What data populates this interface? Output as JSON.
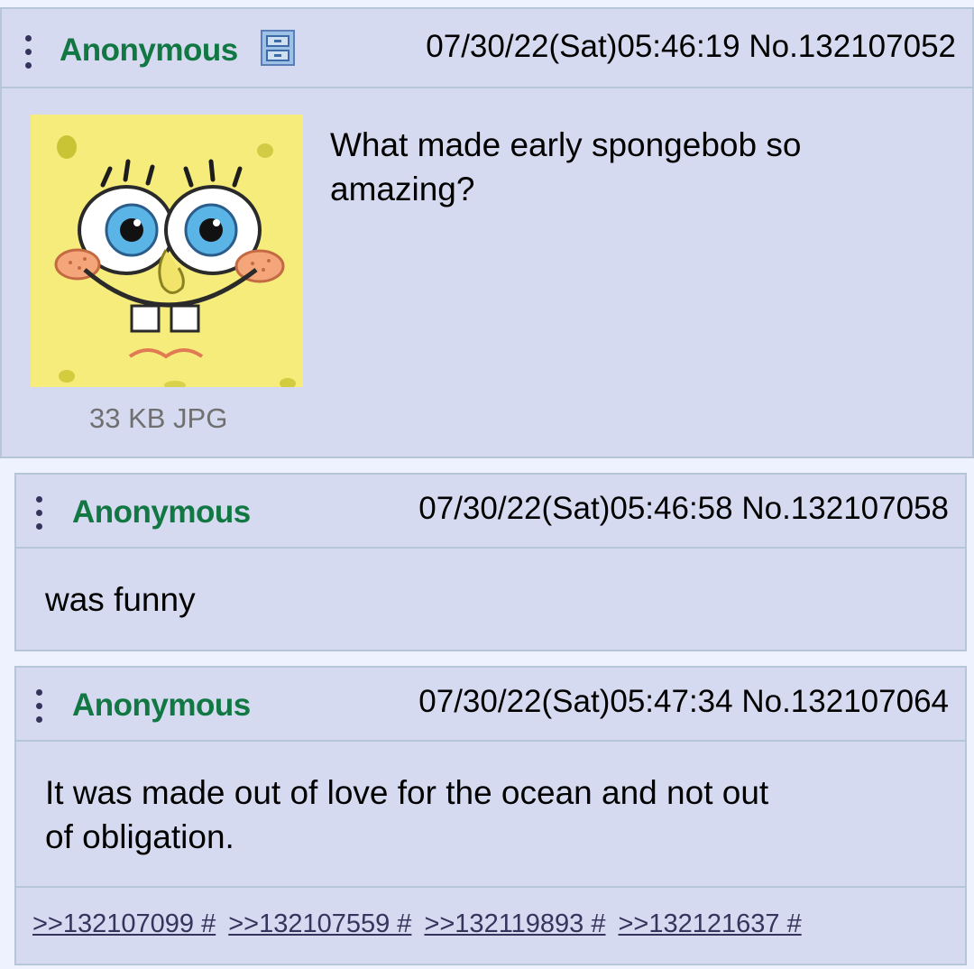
{
  "op": {
    "name": "Anonymous",
    "date": "07/30/22(Sat)05:46:19",
    "post_no": "No.132107052",
    "comment_line1": "What made early spongebob so",
    "comment_line2": "amazing?",
    "file_info": "33 KB JPG",
    "icons": {
      "menu": "menu-dots-icon",
      "file": "file-cabinet-icon",
      "thumbnail": "spongebob-face-thumbnail"
    }
  },
  "replies": [
    {
      "name": "Anonymous",
      "date": "07/30/22(Sat)05:46:58",
      "post_no": "No.132107058",
      "lines": [
        "was funny"
      ]
    },
    {
      "name": "Anonymous",
      "date": "07/30/22(Sat)05:47:34",
      "post_no": "No.132107064",
      "lines": [
        "It was made out of love for the ocean and not out",
        "of obligation."
      ],
      "backlinks": [
        ">>132107099 #",
        ">>132107559 #",
        ">>132119893 #",
        ">>132121637 #"
      ]
    }
  ],
  "colors": {
    "page_bg": "#eef2ff",
    "post_bg": "#d6daf0",
    "border": "#b7c5d9",
    "name": "#117743",
    "link": "#34345c",
    "file_info": "#707070"
  }
}
